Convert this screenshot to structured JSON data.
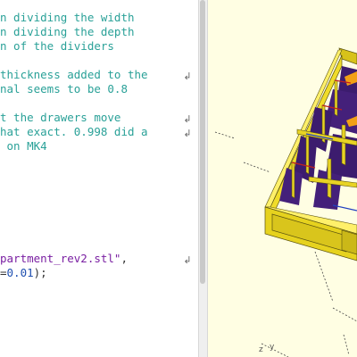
{
  "editor": {
    "lines": [
      {
        "parts": [
          {
            "text": "n dividing the width",
            "cls": ""
          }
        ]
      },
      {
        "parts": [
          {
            "text": "n dividing the depth",
            "cls": ""
          }
        ]
      },
      {
        "parts": [
          {
            "text": "n of the dividers",
            "cls": ""
          }
        ]
      },
      {
        "parts": [
          {
            "text": "thickness added to the",
            "cls": ""
          }
        ]
      },
      {
        "parts": [
          {
            "text": "nal seems to be 0.8",
            "cls": ""
          }
        ]
      },
      {
        "parts": [
          {
            "text": "t the drawers move",
            "cls": ""
          }
        ]
      },
      {
        "parts": [
          {
            "text": "hat exact. 0.998 did a",
            "cls": ""
          }
        ]
      },
      {
        "parts": [
          {
            "text": " on MK4",
            "cls": ""
          }
        ]
      },
      {
        "parts": [
          {
            "text": "partment_rev2.stl\"",
            "cls": "tok-str"
          },
          {
            "text": ",",
            "cls": "plain"
          }
        ]
      },
      {
        "parts": [
          {
            "text": "=",
            "cls": "plain"
          },
          {
            "text": "0.01",
            "cls": "tok-num"
          },
          {
            "text": ");",
            "cls": "plain"
          }
        ]
      }
    ],
    "wrap_marker": "↲"
  },
  "viewport": {
    "background": "#fffee3",
    "model_color": "#e6d21e",
    "interior_color": "#3c1c6e",
    "axis_labels": {
      "z": "z",
      "y": "y"
    }
  }
}
